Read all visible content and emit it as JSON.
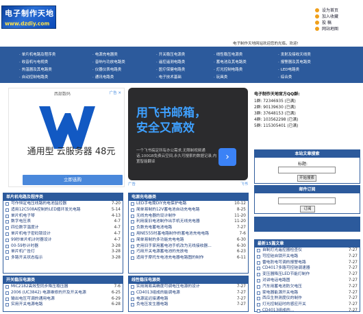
{
  "logo": {
    "line1": "电子制作天地",
    "line2": "www.dzdiy.com"
  },
  "toplinks": [
    "设为首页",
    "加入收藏",
    "投  稿",
    "网站地图"
  ],
  "welcome": "电子制作天地网站欢迎您的光临，欢迎!",
  "nav": [
    [
      "单片机电路及程序类",
      "电源充电器类",
      "开关稳压电源类",
      "线性稳压电源类",
      "发射及接收天线类"
    ],
    [
      "收音机与电视类",
      "音响与功放电路类",
      "遥控遥测电路类",
      "蓄电池及其电路类",
      "报警器及其电路类"
    ],
    [
      "热温器及其电路类",
      "仪器仪表电路类",
      "医疗保健电路类",
      "灯光控制电路类",
      "LED电路类"
    ],
    [
      "自动控制电路类",
      "通讯电路类",
      "电子技术基础",
      "玩具类",
      "综合类"
    ]
  ],
  "ad1": {
    "brand": "西部数码",
    "tag": "广告 ✕",
    "title": "通用型 云服务器 48元",
    "button": "立即选购"
  },
  "ad2": {
    "line1": "用飞书邮箱，",
    "line2": "安全又高效",
    "desc": "一个飞书搞定所有办公需求,无限制视频通话,100GB免费云空间,永久可搜索的数据记录,内置智能翻译",
    "arrow": "›"
  },
  "ad2tags": {
    "left": "广告",
    "right": "飞书"
  },
  "qq": {
    "title": "电子制作天地官方QQ群:",
    "rows": [
      "1群: 72346935  (已满)",
      "2群: 90139630  (已满)",
      "3群: 37648153  (已满)",
      "4群: 103562298  (已满)",
      "5群: 115305401  (已满)"
    ]
  },
  "search": {
    "title": "本站文章搜索",
    "label": "标题:",
    "button": "开始搜索",
    "value": ""
  },
  "mail": {
    "title": "邮件订阅",
    "button": "订阅",
    "value": ""
  },
  "panels": {
    "p1": {
      "title": "单片机电路及程序类",
      "items": [
        [
          "可作恒定电压线路的电池监控器",
          "7-20"
        ],
        [
          "适用12C508A控制的LED循环发光电路",
          "5-14"
        ],
        [
          "单片机电子琴",
          "4-13"
        ],
        [
          "数字电压表",
          "4-7"
        ],
        [
          "四位数字温度计",
          "4-7"
        ],
        [
          "单片机电子密码锁设计",
          "4-7"
        ],
        [
          "99秒单片机计时器设计",
          "4-7"
        ],
        [
          "00-59秒计时器",
          "3-28"
        ],
        [
          "单片机广告灯",
          "3-28"
        ],
        [
          "多路开关状态指示",
          "3-28"
        ]
      ]
    },
    "p2": {
      "title": "电源充电器类",
      "items": [
        [
          "LED手电筒DIY充电保护电路",
          "10-12"
        ],
        [
          "简单易制的12V蓄电池自动充电电路",
          "8-25"
        ],
        [
          "无线充电器的设计制作",
          "11-20"
        ],
        [
          "利用废旧电池制作出手机无线充电器",
          "11-20"
        ],
        [
          "负数充电蓄电池电路",
          "7-27"
        ],
        [
          "用NE555时基电路制作的蓄电池充电电路",
          "7-6"
        ],
        [
          "简单易制的多功能充电电路",
          "6-30"
        ],
        [
          "史用旧手家用蓄电池手机改为无线接收器...",
          "6-30"
        ],
        [
          "巧用开关电源蓄电池的充放电",
          "6-23"
        ],
        [
          "适用于摩托车电池充电器电路图的制作",
          "6-11"
        ]
      ]
    },
    "p3": {
      "title": "开关稳压电源类",
      "items": [
        [
          "MIC2182高效型同步降压稳压器",
          "7-6"
        ],
        [
          "2006 (UC3842) 电源维修的开及开关电源",
          "6-25"
        ],
        [
          "输出电压可调的通用电源",
          "6-29"
        ],
        [
          "实用开关电源电路",
          "6-28"
        ]
      ]
    },
    "p4": {
      "title": "线性稳压电源类",
      "items": [
        [
          "实用简易高精度可调电压电源的设计",
          "7-27"
        ],
        [
          "CD4013组成的能调电源",
          "7-27"
        ],
        [
          "电源延迟接通电路",
          "7-27"
        ],
        [
          "负电压发生器电路",
          "7-27"
        ]
      ]
    },
    "p5": {
      "title": "最新15篇文章",
      "items": [
        [
          "自制灯光遥控器检查仪",
          "7-27"
        ],
        [
          "可控硅自锁开关电路",
          "7-27"
        ],
        [
          "雷电防电可调的报警电路",
          "7-27"
        ],
        [
          "CD4017多路可控硅调速器",
          "7-27"
        ],
        [
          "变压器降压LED节能灯制作",
          "7-27"
        ],
        [
          "对讲电话电路图",
          "7-27"
        ],
        [
          "汽车用蓄电池防欠电压",
          "7-27"
        ],
        [
          "家电器能源开关电路",
          "7-27"
        ],
        [
          "西瓜生熟测度仪的制作",
          "7-27"
        ],
        [
          "灯光控制延时的感应开关",
          "7-27"
        ],
        [
          "CD4013组成的...",
          "7-27"
        ]
      ]
    }
  }
}
